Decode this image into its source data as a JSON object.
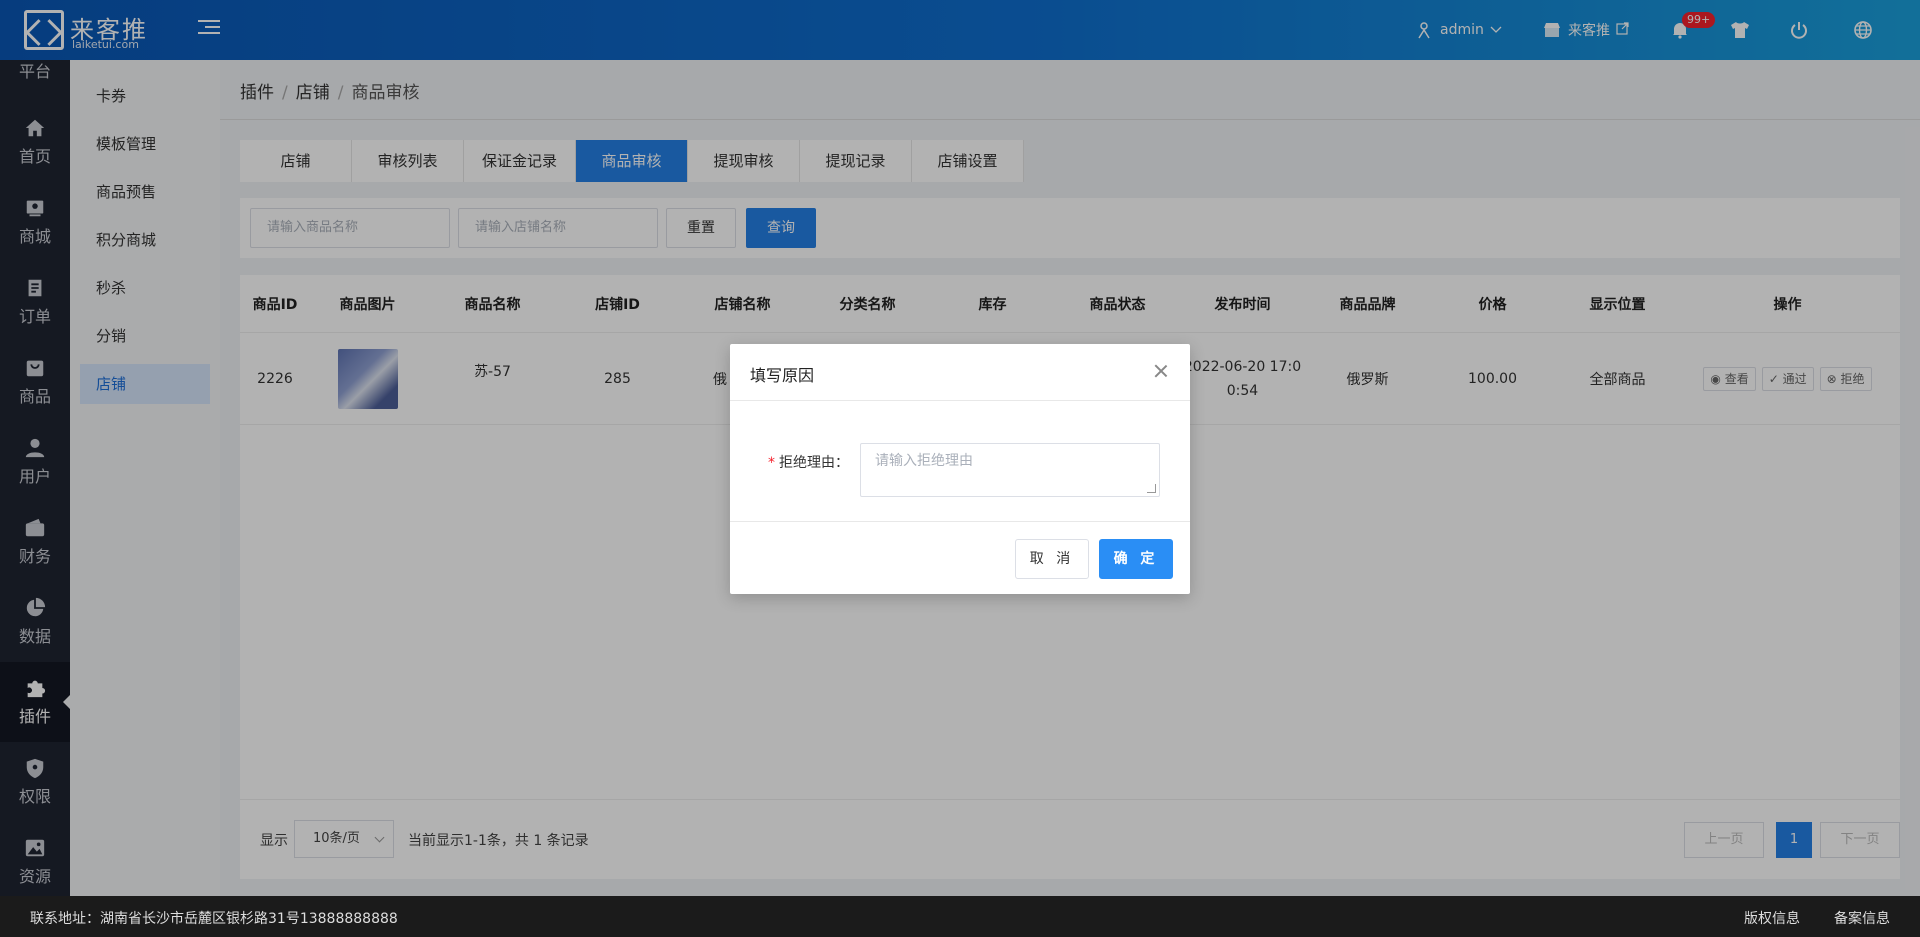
{
  "header": {
    "logo_title": "来客推",
    "logo_sub": "laiketui.com",
    "user": "admin",
    "store": "来客推",
    "badge": "99+",
    "colors": {
      "bar_start": "#0a57b5",
      "bar_end": "#1aa0dc",
      "accent": "#2480e6"
    }
  },
  "sidebar": {
    "top_partial": "平台",
    "items": [
      {
        "label": "首页",
        "icon": "home-icon"
      },
      {
        "label": "商城",
        "icon": "store-icon"
      },
      {
        "label": "订单",
        "icon": "order-icon"
      },
      {
        "label": "商品",
        "icon": "goods-icon"
      },
      {
        "label": "用户",
        "icon": "user-icon"
      },
      {
        "label": "财务",
        "icon": "wallet-icon"
      },
      {
        "label": "数据",
        "icon": "pie-icon"
      },
      {
        "label": "插件",
        "icon": "puzzle-icon"
      },
      {
        "label": "权限",
        "icon": "shield-icon"
      },
      {
        "label": "资源",
        "icon": "image-icon"
      }
    ]
  },
  "submenu": {
    "items": [
      "卡券",
      "模板管理",
      "商品预售",
      "积分商城",
      "秒杀",
      "分销",
      "店铺"
    ]
  },
  "breadcrumb": {
    "a": "插件",
    "b": "店铺",
    "c": "商品审核",
    "sep": "/"
  },
  "tabs": [
    "店铺",
    "审核列表",
    "保证金记录",
    "商品审核",
    "提现审核",
    "提现记录",
    "店铺设置"
  ],
  "filter": {
    "goods_placeholder": "请输入商品名称",
    "shop_placeholder": "请输入店铺名称",
    "reset": "重置",
    "query": "查询"
  },
  "table": {
    "headers": [
      "商品ID",
      "商品图片",
      "商品名称",
      "店铺ID",
      "店铺名称",
      "分类名称",
      "库存",
      "商品状态",
      "发布时间",
      "商品品牌",
      "价格",
      "显示位置",
      "操作"
    ],
    "row": {
      "id": "2226",
      "name": "苏-57",
      "shop_id": "285",
      "shop_name_partial": "俄",
      "time_line1": "2022-06-20 17:0",
      "time_line2": "0:54",
      "brand": "俄罗斯",
      "price": "100.00",
      "position": "全部商品",
      "ops": [
        "查看",
        "通过",
        "拒绝"
      ]
    }
  },
  "pager": {
    "label": "显示",
    "size": "10条/页",
    "info": "当前显示1-1条，共 1 条记录",
    "prev": "上一页",
    "page": "1",
    "next": "下一页"
  },
  "footer": {
    "address": "联系地址：湖南省长沙市岳麓区银杉路31号13888888888",
    "links": [
      "版权信息",
      "备案信息"
    ]
  },
  "modal": {
    "title": "填写原因",
    "required_mark": "*",
    "label": "拒绝理由：",
    "placeholder": "请输入拒绝理由",
    "cancel": "取 消",
    "ok": "确 定"
  }
}
